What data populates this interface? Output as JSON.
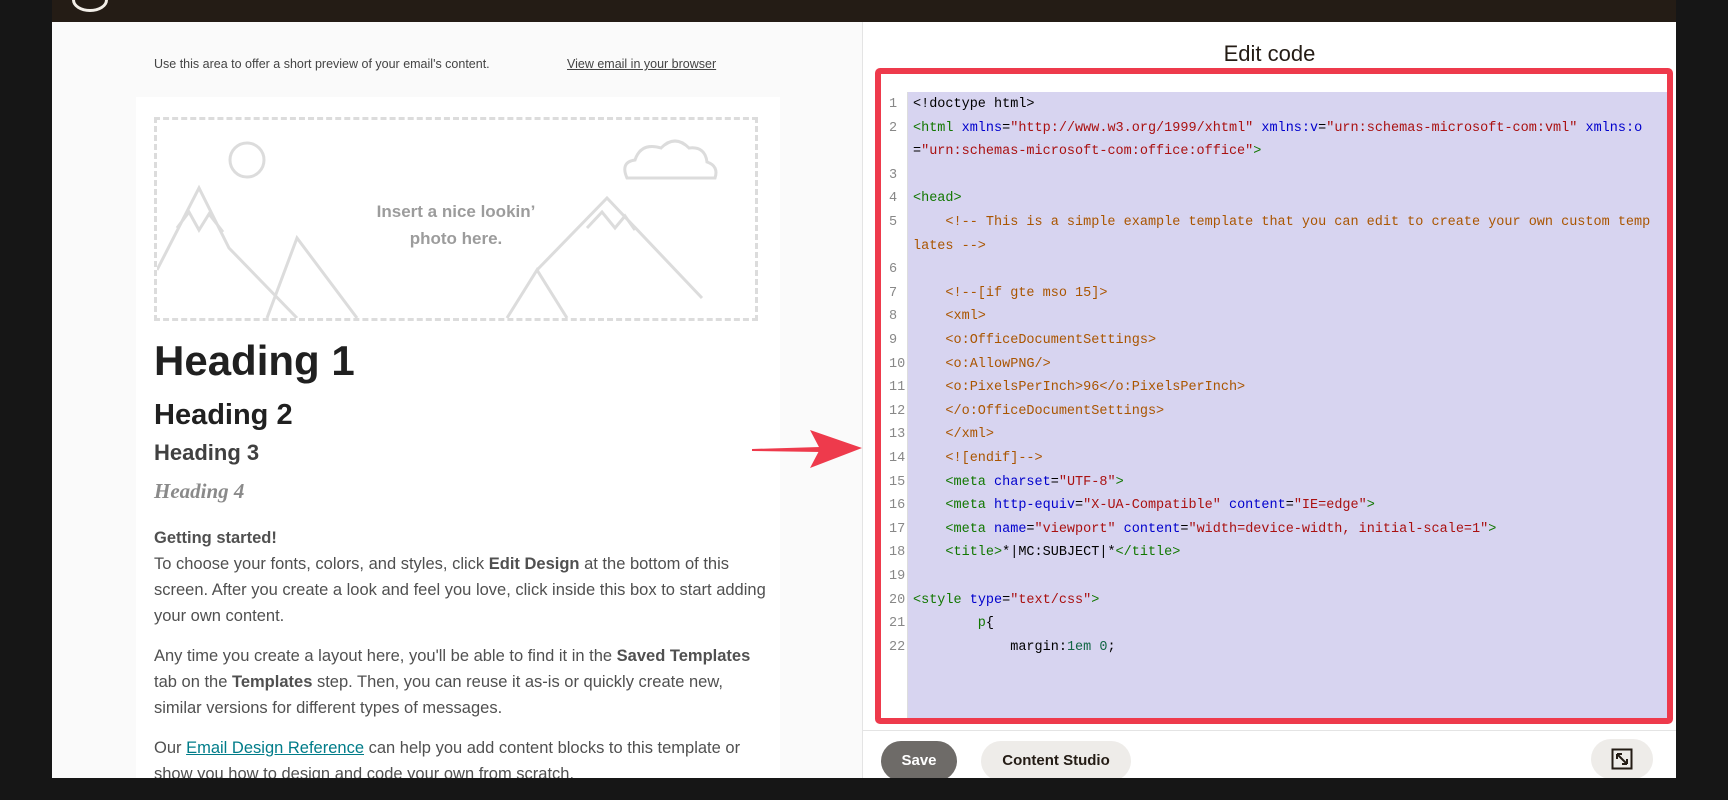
{
  "app": {
    "preview_text": "Use this area to offer a short preview of your email's content.",
    "view_in_browser": "View email in your browser"
  },
  "email": {
    "image_placeholder": "Insert a nice lookin’\nphoto here.",
    "heading1": "Heading 1",
    "heading2": "Heading 2",
    "heading3": "Heading 3",
    "heading4": "Heading 4",
    "getting_started": "Getting started!",
    "p1_a": "To choose your fonts, colors, and styles, click ",
    "p1_bold": "Edit Design",
    "p1_b": " at the bottom of this screen. After you create a look and feel you love, click inside this box to start adding your own content.",
    "p2_a": "Any time you create a layout here, you'll be able to find it in the ",
    "p2_bold1": "Saved Templates",
    "p2_b": " tab on the ",
    "p2_bold2": "Templates",
    "p2_c": " step. Then, you can reuse it as-is or quickly create new, similar versions for different types of messages.",
    "p3_a": "Our ",
    "p3_link": "Email Design Reference",
    "p3_b": " can help you add content blocks to this template or show you how to design and code your own from scratch."
  },
  "editor": {
    "title": "Edit code",
    "save_label": "Save",
    "content_studio_label": "Content Studio",
    "lines": [
      {
        "n": "1",
        "t": [
          [
            "plain",
            "<!doctype html>"
          ]
        ]
      },
      {
        "n": "2",
        "t": [
          [
            "tag",
            "<html "
          ],
          [
            "attr",
            "xmlns"
          ],
          [
            "plain",
            "="
          ],
          [
            "str",
            "\"http://www.w3.org/1999/xhtml\""
          ],
          [
            "plain",
            " "
          ],
          [
            "attr",
            "xmlns:v"
          ],
          [
            "plain",
            "="
          ],
          [
            "str",
            "\"urn:schemas-microsoft-com:vml\""
          ],
          [
            "plain",
            " "
          ],
          [
            "attr",
            "xmlns:o"
          ]
        ]
      },
      {
        "n": "",
        "t": [
          [
            "plain",
            "="
          ],
          [
            "str",
            "\"urn:schemas-microsoft-com:office:office\""
          ],
          [
            "tag",
            ">"
          ]
        ]
      },
      {
        "n": "3",
        "t": []
      },
      {
        "n": "4",
        "t": [
          [
            "tag",
            "<head>"
          ]
        ]
      },
      {
        "n": "5",
        "t": [
          [
            "cmt",
            "    <!-- This is a simple example template that you can edit to create your own custom temp"
          ]
        ]
      },
      {
        "n": "",
        "t": [
          [
            "cmt",
            "lates -->"
          ]
        ]
      },
      {
        "n": "6",
        "t": []
      },
      {
        "n": "7",
        "t": [
          [
            "cmt",
            "    <!--[if gte mso 15]>"
          ]
        ]
      },
      {
        "n": "8",
        "t": [
          [
            "cmt",
            "    <xml>"
          ]
        ]
      },
      {
        "n": "9",
        "t": [
          [
            "cmt",
            "    <o:OfficeDocumentSettings>"
          ]
        ]
      },
      {
        "n": "10",
        "t": [
          [
            "cmt",
            "    <o:AllowPNG/>"
          ]
        ]
      },
      {
        "n": "11",
        "t": [
          [
            "cmt",
            "    <o:PixelsPerInch>96</o:PixelsPerInch>"
          ]
        ]
      },
      {
        "n": "12",
        "t": [
          [
            "cmt",
            "    </o:OfficeDocumentSettings>"
          ]
        ]
      },
      {
        "n": "13",
        "t": [
          [
            "cmt",
            "    </xml>"
          ]
        ]
      },
      {
        "n": "14",
        "t": [
          [
            "cmt",
            "    <![endif]-->"
          ]
        ]
      },
      {
        "n": "15",
        "t": [
          [
            "tag",
            "    <meta "
          ],
          [
            "attr",
            "charset"
          ],
          [
            "plain",
            "="
          ],
          [
            "str",
            "\"UTF-8\""
          ],
          [
            "tag",
            ">"
          ]
        ]
      },
      {
        "n": "16",
        "t": [
          [
            "tag",
            "    <meta "
          ],
          [
            "attr",
            "http-equiv"
          ],
          [
            "plain",
            "="
          ],
          [
            "str",
            "\"X-UA-Compatible\""
          ],
          [
            "plain",
            " "
          ],
          [
            "attr",
            "content"
          ],
          [
            "plain",
            "="
          ],
          [
            "str",
            "\"IE=edge\""
          ],
          [
            "tag",
            ">"
          ]
        ]
      },
      {
        "n": "17",
        "t": [
          [
            "tag",
            "    <meta "
          ],
          [
            "attr",
            "name"
          ],
          [
            "plain",
            "="
          ],
          [
            "str",
            "\"viewport\""
          ],
          [
            "plain",
            " "
          ],
          [
            "attr",
            "content"
          ],
          [
            "plain",
            "="
          ],
          [
            "str",
            "\"width=device-width, initial-scale=1\""
          ],
          [
            "tag",
            ">"
          ]
        ]
      },
      {
        "n": "18",
        "t": [
          [
            "tag",
            "    <title>"
          ],
          [
            "plain",
            "*|MC:SUBJECT|*"
          ],
          [
            "tag",
            "</title>"
          ]
        ]
      },
      {
        "n": "19",
        "t": []
      },
      {
        "n": "20",
        "t": [
          [
            "tag",
            "<style "
          ],
          [
            "attr",
            "type"
          ],
          [
            "plain",
            "="
          ],
          [
            "str",
            "\"text/css\""
          ],
          [
            "tag",
            ">"
          ]
        ]
      },
      {
        "n": "21",
        "t": [
          [
            "tag",
            "        p"
          ],
          [
            "plain",
            "{"
          ]
        ]
      },
      {
        "n": "22",
        "t": [
          [
            "plain",
            "            margin:"
          ],
          [
            "num",
            "1em 0"
          ],
          [
            "plain",
            ";"
          ]
        ]
      }
    ]
  },
  "colors": {
    "highlight": "#ee3a4c",
    "selection": "#d7d4f0",
    "topbar": "#241c15",
    "link": "#007c89"
  }
}
